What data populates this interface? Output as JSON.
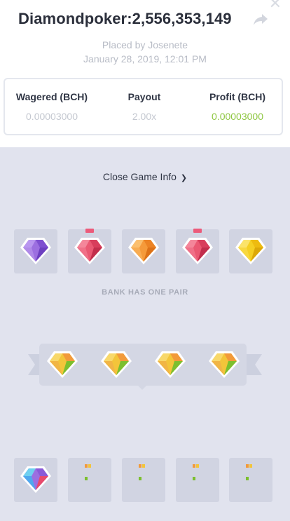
{
  "header": {
    "title": "Diamondpoker:2,556,353,149",
    "placed_by": "Placed by Josenete",
    "date": "January 28, 2019, 12:01 PM"
  },
  "stats": {
    "wagered_label": "Wagered (BCH)",
    "wagered_value": "0.00003000",
    "payout_label": "Payout",
    "payout_value": "2.00x",
    "profit_label": "Profit (BCH)",
    "profit_value": "0.00003000"
  },
  "game": {
    "toggle_label": "Close Game Info",
    "bank_result": "BANK HAS ONE PAIR",
    "bank_gems": [
      "purple",
      "red",
      "orange",
      "red",
      "yellow"
    ],
    "ribbon_gems": [
      "multicolor",
      "multicolor",
      "multicolor",
      "multicolor"
    ],
    "player_gems": [
      "rainbow",
      "hidden",
      "hidden",
      "hidden",
      "hidden"
    ]
  },
  "colors": {
    "profit": "#8dc63f",
    "background": "#e1e3ee",
    "slot": "#d1d4e2"
  }
}
